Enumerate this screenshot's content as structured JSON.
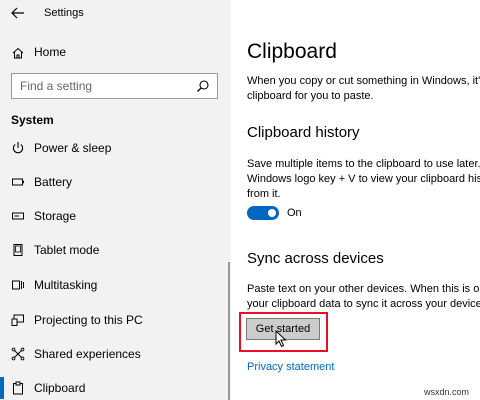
{
  "titlebar": {
    "app_title": "Settings"
  },
  "sidebar": {
    "home_label": "Home",
    "search_placeholder": "Find a setting",
    "section_title": "System",
    "items": [
      {
        "label": "Power & sleep",
        "icon": "power-icon"
      },
      {
        "label": "Battery",
        "icon": "battery-icon"
      },
      {
        "label": "Storage",
        "icon": "storage-icon"
      },
      {
        "label": "Tablet mode",
        "icon": "tablet-mode-icon"
      },
      {
        "label": "Multitasking",
        "icon": "multitasking-icon"
      },
      {
        "label": "Projecting to this PC",
        "icon": "projecting-icon"
      },
      {
        "label": "Shared experiences",
        "icon": "shared-experiences-icon"
      },
      {
        "label": "Clipboard",
        "icon": "clipboard-icon",
        "selected": true
      }
    ]
  },
  "main": {
    "title": "Clipboard",
    "intro_lines": [
      "When you copy or cut something in Windows, it's",
      "clipboard for you to paste."
    ],
    "history": {
      "heading": "Clipboard history",
      "lines": [
        "Save multiple items to the clipboard to use later.",
        "Windows logo key + V to view your clipboard his",
        "from it."
      ],
      "toggle_state": "On"
    },
    "sync": {
      "heading": "Sync across devices",
      "lines": [
        "Paste text on your other devices. When this is on,",
        "your clipboard data to sync it across your devices"
      ],
      "button_label": "Get started"
    },
    "privacy_link": "Privacy statement"
  },
  "watermark": "wsxdn.com",
  "colors": {
    "accent": "#0067c0",
    "highlight": "#e81123",
    "sidebar_bg": "#f2f2f2"
  }
}
